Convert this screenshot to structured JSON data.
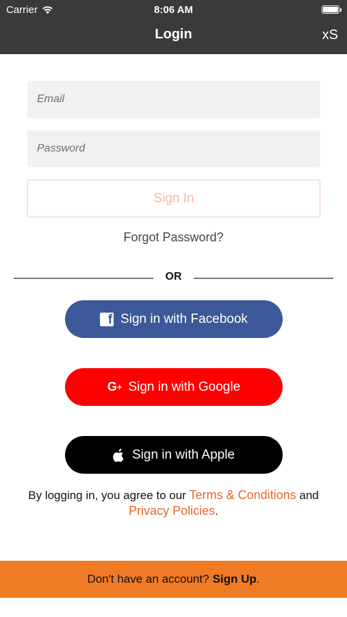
{
  "status_bar": {
    "carrier": "Carrier",
    "time": "8:06 AM",
    "battery_level": 1.0
  },
  "nav": {
    "title": "Login",
    "right_label": "xS"
  },
  "form": {
    "email_placeholder": "Email",
    "email_value": "",
    "password_placeholder": "Password",
    "password_value": "",
    "signin_label": "Sign In",
    "forgot_label": "Forgot Password?"
  },
  "divider": {
    "label": "OR"
  },
  "social": {
    "facebook_label": "Sign in with Facebook",
    "google_label": "Sign in with Google",
    "google_icon_text": "G",
    "google_icon_plus": "+",
    "apple_label": "Sign in with Apple",
    "facebook_icon_text": "f"
  },
  "legal": {
    "prefix": "By logging in, you agree to our ",
    "terms_label": "Terms & Conditions",
    "middle": " and",
    "privacy_label": "Privacy Policies",
    "suffix": "."
  },
  "signup": {
    "prompt": "Don't have an account?",
    "link_label": "Sign Up",
    "suffix": "."
  },
  "colors": {
    "header_bg": "#3a3a3a",
    "accent_orange": "#f07b25",
    "link_orange": "#e9662c",
    "facebook_blue": "#3b5998",
    "google_red": "#ff0000",
    "apple_black": "#000000"
  },
  "icons": {
    "wifi": "wifi-icon",
    "battery": "battery-icon",
    "facebook": "facebook-icon",
    "google": "google-plus-icon",
    "apple": "apple-icon"
  }
}
